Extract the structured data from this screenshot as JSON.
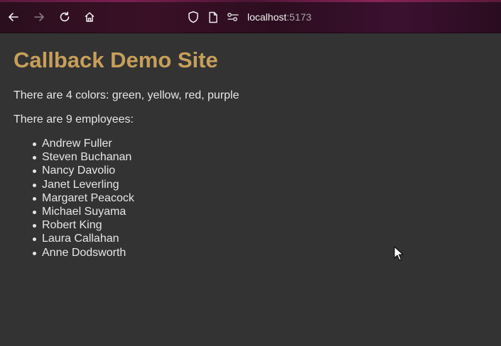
{
  "browser": {
    "url_host": "localhost",
    "url_port": ":5173",
    "icons": [
      "back-arrow-icon",
      "forward-arrow-icon",
      "reload-icon",
      "home-icon",
      "shield-icon",
      "page-icon",
      "permissions-icon"
    ]
  },
  "page": {
    "title": "Callback Demo Site",
    "colors_text": "There are 4 colors: green, yellow, red, purple",
    "employees_text": "There are 9 employees:",
    "employees": [
      "Andrew Fuller",
      "Steven Buchanan",
      "Nancy Davolio",
      "Janet Leverling",
      "Margaret Peacock",
      "Michael Suyama",
      "Robert King",
      "Laura Callahan",
      "Anne Dodsworth"
    ]
  },
  "theme": {
    "title_color": "#c79f5a",
    "text_color": "#e6e6e6",
    "background": "#333333"
  }
}
